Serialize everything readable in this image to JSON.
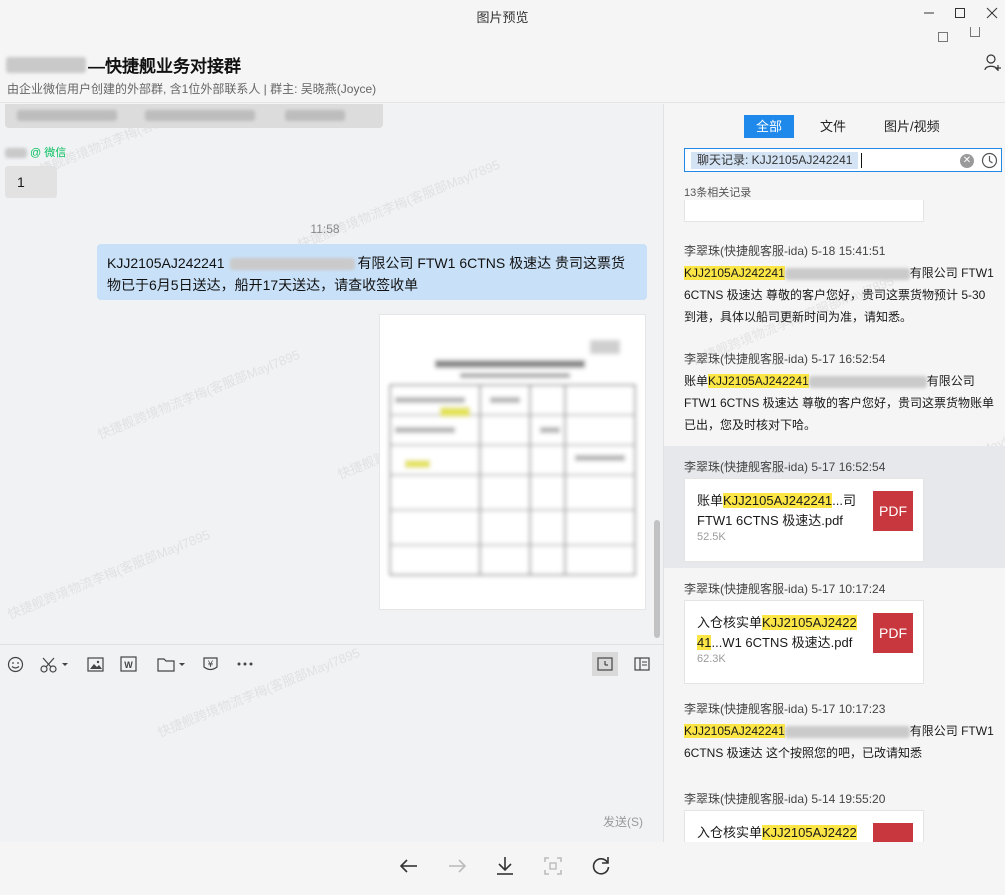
{
  "window": {
    "title": "图片预览"
  },
  "header": {
    "group_name": "—快捷舰业务对接群",
    "group_sub": "由企业微信用户创建的外部群, 含1位外部联系人 | 群主: 吴晓燕(Joyce)"
  },
  "chat": {
    "sender_tag": "@ 微信",
    "msg_one": "1",
    "time": "11:58",
    "my_message_id": "KJJ2105AJ242241",
    "my_message_rest": "有限公司 FTW1 6CTNS 极速达   贵司这票货物已于6月5日送达，船开17天送达，请查收签收单",
    "send_label": "发送(S)"
  },
  "watermark": "快捷舰跨境物流李梅(客服部Mayl7895",
  "side": {
    "tabs": [
      "全部",
      "文件",
      "图片/视频"
    ],
    "search_value": "聊天记录: KJJ2105AJ242241",
    "count": "13条相关记录",
    "results": [
      {
        "meta": "李翠珠(快捷舰客服-ida) 5-18 15:41:51",
        "prefix": "",
        "hl": "KJJ2105AJ242241",
        "mid": "有限公司 FTW1",
        "rest": "6CTNS 极速达  尊敬的客户您好，贵司这票货物预计        5-30  到港，具体以船司更新时间为准，请知悉。"
      },
      {
        "meta": "李翠珠(快捷舰客服-ida) 5-17 16:52:54",
        "prefix": "账单",
        "hl": "KJJ2105AJ242241",
        "mid": "有限公司",
        "rest": "FTW1 6CTNS 极速达 尊敬的客户您好，贵司这票货物账单已出，您及时核对下哈。"
      },
      {
        "meta": "李翠珠(快捷舰客服-ida) 5-17 16:52:54",
        "file_prefix": "账单",
        "file_hl": "KJJ2105AJ242241",
        "file_suffix": "...司",
        "file_line2": " FTW1 6CTNS 极速达.pdf",
        "size": "52.5K",
        "badge": "PDF"
      },
      {
        "meta": "李翠珠(快捷舰客服-ida) 5-17 10:17:24",
        "file_prefix": "入仓核实单",
        "file_hl": "KJJ2105AJ2422",
        "file_hl2": "41",
        "file_suffix": "...W1 6CTNS 极速达.pdf",
        "size": "62.3K",
        "badge": "PDF"
      },
      {
        "meta": "李翠珠(快捷舰客服-ida) 5-17 10:17:23",
        "prefix": "",
        "hl": "KJJ2105AJ242241",
        "mid": "有限公司 FTW1",
        "rest": "6CTNS 极速达  这个按照您的吧，已改请知悉"
      },
      {
        "meta": "李翠珠(快捷舰客服-ida) 5-14 19:55:20",
        "file_prefix": "入仓核实单",
        "file_hl": "KJJ2105AJ2422"
      }
    ]
  },
  "colors": {
    "accent": "#1e89ea",
    "bubble_me": "#c9e1f8",
    "highlight": "#fce646",
    "pdf": "#c8373d",
    "wechat_green": "#07c160"
  }
}
